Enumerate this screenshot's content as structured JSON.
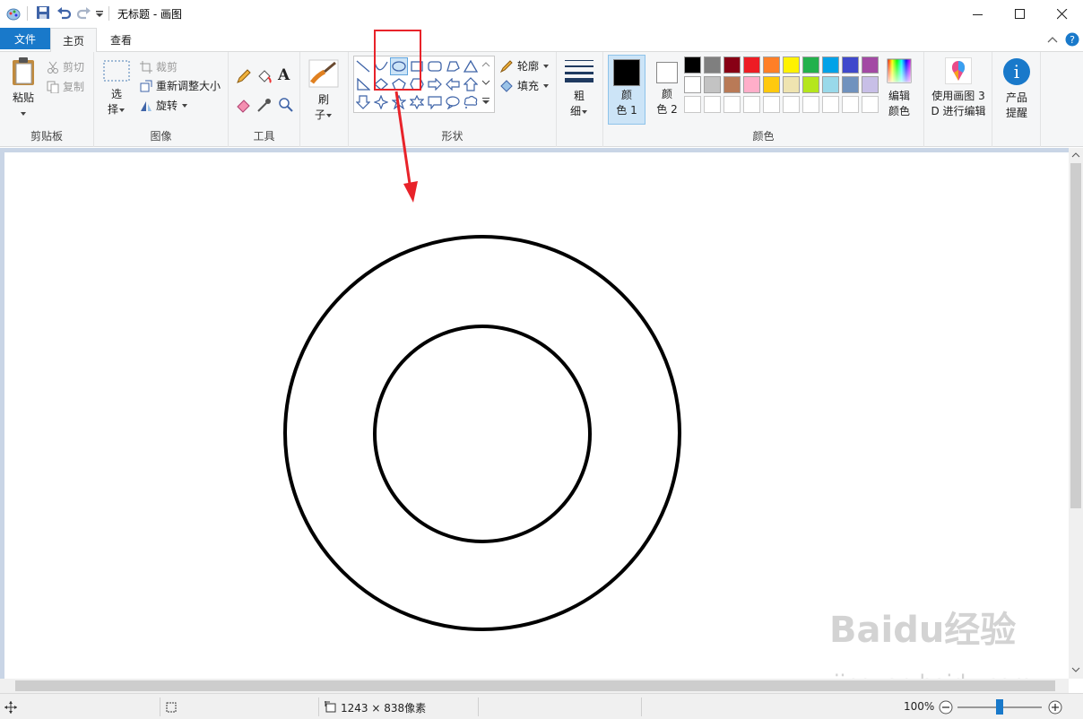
{
  "window": {
    "title": "无标题 - 画图"
  },
  "tabs": {
    "file": "文件",
    "home": "主页",
    "view": "查看"
  },
  "clipboard": {
    "paste": "粘贴",
    "cut": "剪切",
    "copy": "复制",
    "label": "剪贴板"
  },
  "image": {
    "select": "选",
    "select2": "择",
    "crop": "裁剪",
    "resize": "重新调整大小",
    "rotate": "旋转",
    "label": "图像"
  },
  "tools": {
    "label": "工具",
    "text_tool": "A"
  },
  "brushes": {
    "label1": "刷",
    "label2": "子"
  },
  "shapes": {
    "outline": "轮廓",
    "fill": "填充",
    "label": "形状"
  },
  "size": {
    "label1": "粗",
    "label2": "细"
  },
  "colors": {
    "color1_a": "颜",
    "color1_b": "色 1",
    "color2_a": "颜",
    "color2_b": "色 2",
    "edit_a": "编辑",
    "edit_b": "颜色",
    "label": "颜色",
    "palette_row1": [
      "#000000",
      "#7f7f7f",
      "#880015",
      "#ed1c24",
      "#ff7f27",
      "#fff200",
      "#22b14c",
      "#00a2e8",
      "#3f48cc",
      "#a349a4"
    ],
    "palette_row2": [
      "#ffffff",
      "#c3c3c3",
      "#b97a57",
      "#ffaec9",
      "#ffc90e",
      "#efe4b0",
      "#b5e61d",
      "#99d9ea",
      "#7092be",
      "#c8bfe7"
    ]
  },
  "paint3d": {
    "line1": "使用画图 3",
    "line2": "D 进行编辑"
  },
  "product_tips": {
    "line1": "产品",
    "line2": "提醒",
    "icon": "i"
  },
  "status": {
    "dimensions": "1243 × 838像素",
    "zoom": "100%"
  },
  "watermark": {
    "brand": "Baidu经验",
    "url": "jingyan.baidu.com"
  }
}
